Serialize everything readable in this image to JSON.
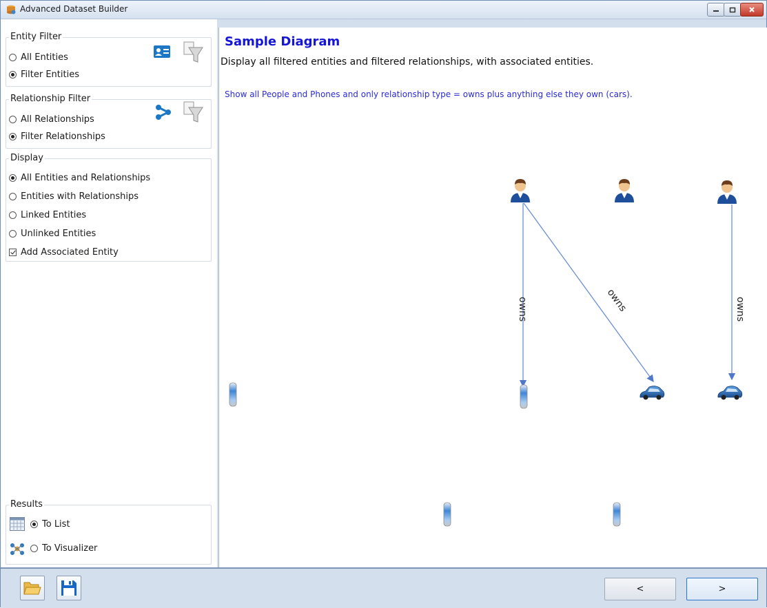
{
  "window": {
    "title": "Advanced Dataset Builder"
  },
  "entity_filter": {
    "legend": "Entity Filter",
    "options": [
      "All Entities",
      "Filter Entities"
    ],
    "selected": "Filter Entities"
  },
  "relationship_filter": {
    "legend": "Relationship Filter",
    "options": [
      "All Relationships",
      "Filter Relationships"
    ],
    "selected": "Filter Relationships"
  },
  "display": {
    "legend": "Display",
    "options": [
      "All Entities and Relationships",
      "Entities with Relationships",
      "Linked Entities",
      "Unlinked Entities"
    ],
    "selected": "All Entities and Relationships",
    "add_associated_label": "Add Associated Entity",
    "add_associated_checked": true
  },
  "results": {
    "legend": "Results",
    "options": [
      "To List",
      "To Visualizer"
    ],
    "selected": "To List"
  },
  "diagram": {
    "title": "Sample Diagram",
    "description": "Display all filtered entities and filtered relationships, with associated entities.",
    "note": "Show all People and Phones and only relationship type = owns plus anything else they own (cars).",
    "edge_label": "owns",
    "colors": {
      "title": "#1515d6",
      "note": "#2b2bd8",
      "edge": "#6b8fd6"
    }
  },
  "bottom": {
    "open_icon": "folder-open-icon",
    "save_icon": "save-icon",
    "prev_label": "<",
    "next_label": ">"
  }
}
